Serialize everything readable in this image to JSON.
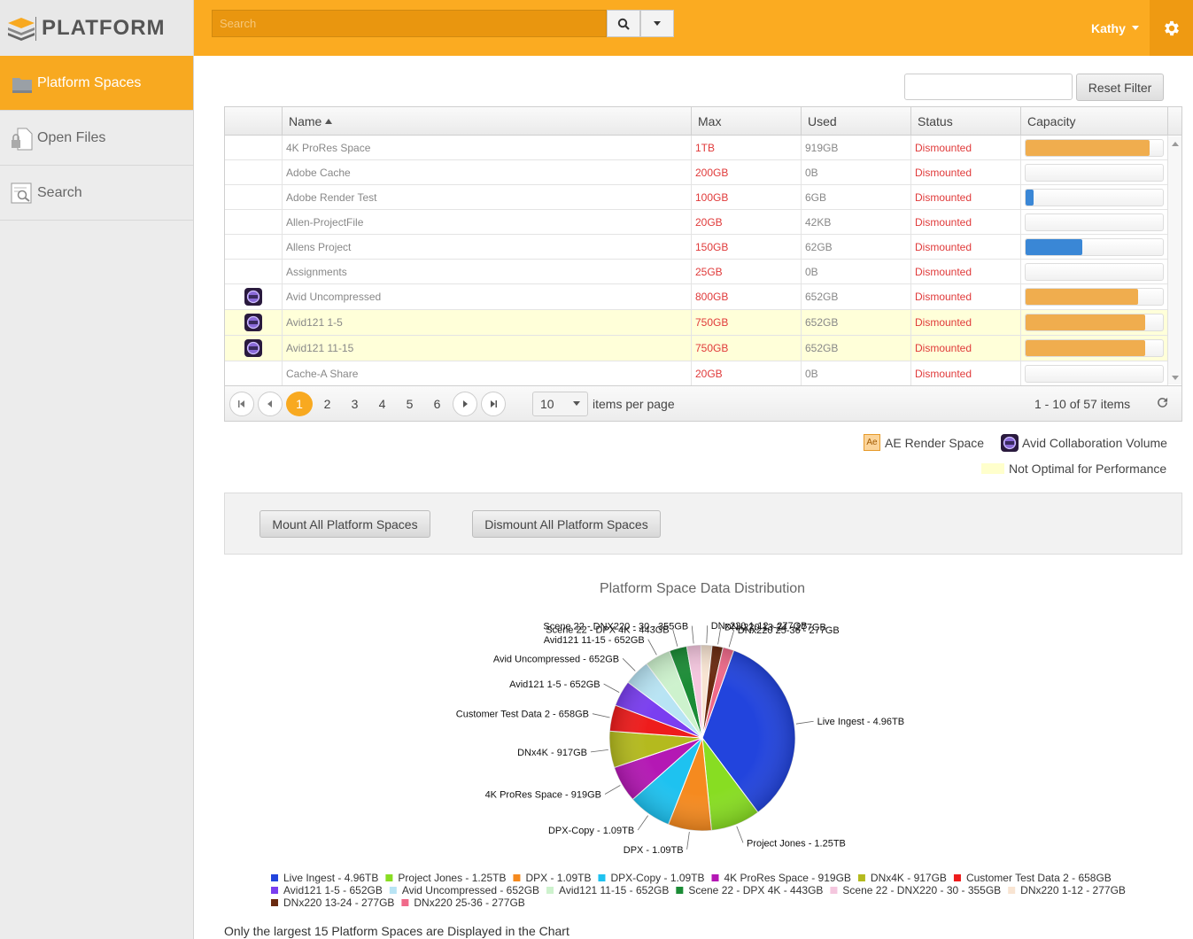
{
  "brand": {
    "name": "PLATFORM"
  },
  "sidebar": {
    "items": [
      {
        "label": "Platform Spaces",
        "icon": "folder-icon",
        "active": true
      },
      {
        "label": "Open Files",
        "icon": "locked-file-icon"
      },
      {
        "label": "Search",
        "icon": "search-doc-icon"
      }
    ]
  },
  "header": {
    "search_placeholder": "Search",
    "user": "Kathy"
  },
  "filter": {
    "value": "",
    "reset_label": "Reset Filter"
  },
  "grid": {
    "columns": [
      "Name",
      "Max",
      "Used",
      "Status",
      "Capacity"
    ],
    "rows": [
      {
        "name": "4K ProRes Space",
        "max": "1TB",
        "used": "919GB",
        "status": "Dismounted",
        "fill": 0.9,
        "color": "#f0ad4e",
        "icon": false,
        "warn": false
      },
      {
        "name": "Adobe Cache",
        "max": "200GB",
        "used": "0B",
        "status": "Dismounted",
        "fill": 0,
        "color": "#f0ad4e",
        "icon": false,
        "warn": false
      },
      {
        "name": "Adobe Render Test",
        "max": "100GB",
        "used": "6GB",
        "status": "Dismounted",
        "fill": 0.06,
        "color": "#3a87d6",
        "icon": false,
        "warn": false
      },
      {
        "name": "Allen-ProjectFile",
        "max": "20GB",
        "used": "42KB",
        "status": "Dismounted",
        "fill": 0,
        "color": "#f0ad4e",
        "icon": false,
        "warn": false
      },
      {
        "name": "Allens Project",
        "max": "150GB",
        "used": "62GB",
        "status": "Dismounted",
        "fill": 0.41,
        "color": "#3a87d6",
        "icon": false,
        "warn": false
      },
      {
        "name": "Assignments",
        "max": "25GB",
        "used": "0B",
        "status": "Dismounted",
        "fill": 0,
        "color": "#f0ad4e",
        "icon": false,
        "warn": false
      },
      {
        "name": "Avid Uncompressed",
        "max": "800GB",
        "used": "652GB",
        "status": "Dismounted",
        "fill": 0.82,
        "color": "#f0ad4e",
        "icon": true,
        "warn": false
      },
      {
        "name": "Avid121 1-5",
        "max": "750GB",
        "used": "652GB",
        "status": "Dismounted",
        "fill": 0.87,
        "color": "#f0ad4e",
        "icon": true,
        "warn": true
      },
      {
        "name": "Avid121 11-15",
        "max": "750GB",
        "used": "652GB",
        "status": "Dismounted",
        "fill": 0.87,
        "color": "#f0ad4e",
        "icon": true,
        "warn": true
      },
      {
        "name": "Cache-A Share",
        "max": "20GB",
        "used": "0B",
        "status": "Dismounted",
        "fill": 0,
        "color": "#f0ad4e",
        "icon": false,
        "warn": false
      }
    ]
  },
  "pager": {
    "pages": [
      "1",
      "2",
      "3",
      "4",
      "5",
      "6"
    ],
    "current": "1",
    "per_page": "10",
    "per_page_label": "items per page",
    "summary": "1 - 10 of 57 items"
  },
  "legend": {
    "ae": "AE Render Space",
    "avid": "Avid Collaboration Volume",
    "not_optimal": "Not Optimal for Performance",
    "ae_icon_text": "Ae"
  },
  "actions": {
    "mount": "Mount All Platform Spaces",
    "dismount": "Dismount All Platform Spaces"
  },
  "chart_data": {
    "type": "pie",
    "title": "Platform Space Data Distribution",
    "slices": [
      {
        "label": "Live Ingest - 4.96TB",
        "value": 4.96,
        "color": "#2244dd"
      },
      {
        "label": "Project Jones - 1.25TB",
        "value": 1.25,
        "color": "#88dd22"
      },
      {
        "label": "DPX - 1.09TB",
        "value": 1.09,
        "color": "#f58a1f"
      },
      {
        "label": "DPX-Copy - 1.09TB",
        "value": 1.09,
        "color": "#1ec2f0"
      },
      {
        "label": "4K ProRes Space - 919GB",
        "value": 0.919,
        "color": "#b418b4"
      },
      {
        "label": "DNx4K - 917GB",
        "value": 0.917,
        "color": "#b4ba1e"
      },
      {
        "label": "Customer Test Data 2 - 658GB",
        "value": 0.658,
        "color": "#ee1c1c"
      },
      {
        "label": "Avid121 1-5 - 652GB",
        "value": 0.652,
        "color": "#7a3ef0"
      },
      {
        "label": "Avid Uncompressed - 652GB",
        "value": 0.652,
        "color": "#b8e4f4"
      },
      {
        "label": "Avid121 11-15 - 652GB",
        "value": 0.652,
        "color": "#cdf2cd"
      },
      {
        "label": "Scene 22 - DPX 4K - 443GB",
        "value": 0.443,
        "color": "#1b8c36"
      },
      {
        "label": "Scene 22 - DNX220 - 30 - 355GB",
        "value": 0.355,
        "color": "#f4c6de"
      },
      {
        "label": "DNx220 1-12 - 277GB",
        "value": 0.277,
        "color": "#f8e4d2"
      },
      {
        "label": "DNx220 13-24 - 277GB",
        "value": 0.277,
        "color": "#6a2a10"
      },
      {
        "label": "DNx220 25-36 - 277GB",
        "value": 0.277,
        "color": "#f06a8a"
      }
    ]
  },
  "chart_footnote": "Only the largest 15 Platform Spaces are Displayed in the Chart"
}
